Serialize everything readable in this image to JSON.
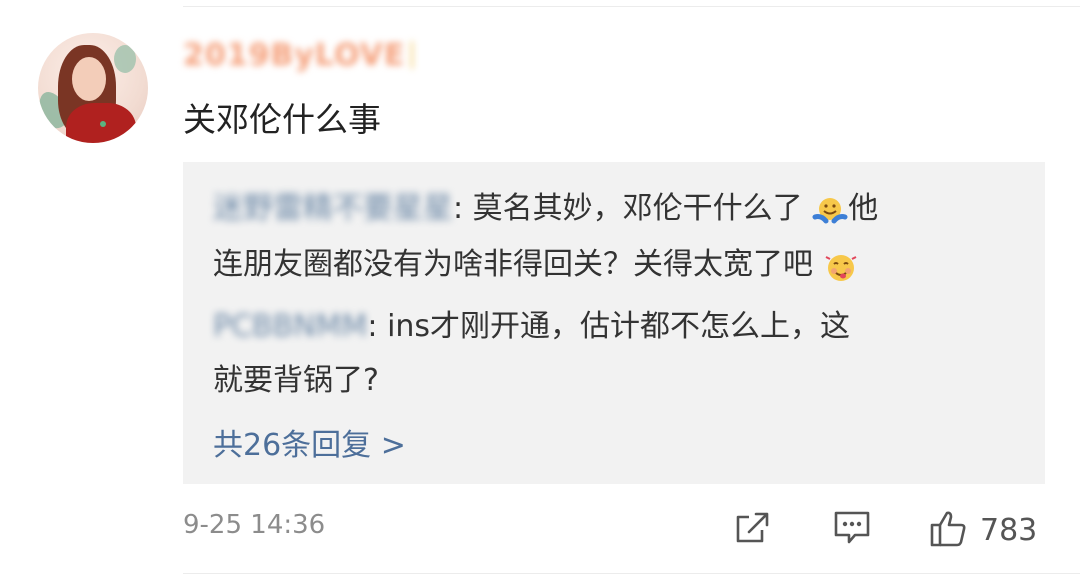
{
  "comment": {
    "username": "2019ByLOVE",
    "text": "关邓伦什么事",
    "timestamp": "9-25 14:36",
    "like_count": "783"
  },
  "replies": {
    "items": [
      {
        "author": "迷野雷精不要星星",
        "line1": ": 莫名其妙，邓伦干什么了",
        "line1_tail": "他",
        "line2": "连朋友圈都没有为啥非得回关？关得太宽了吧"
      },
      {
        "author": "PCBBNMM",
        "line1": ": ins才刚开通，估计都不怎么上，这",
        "line2": "就要背锅了?"
      }
    ],
    "more_label": "共26条回复 >"
  },
  "icons": {
    "share": "share-icon",
    "comment": "comment-icon",
    "like": "thumbs-up-icon",
    "emoji1": "hugging-face-icon",
    "emoji2": "yum-face-icon",
    "avatar": "avatar-image"
  },
  "colors": {
    "reply_bg": "#f2f2f2",
    "link": "#4d6f9a",
    "username": "#f5a07b",
    "text": "#222222",
    "muted": "#8c8c8c"
  }
}
